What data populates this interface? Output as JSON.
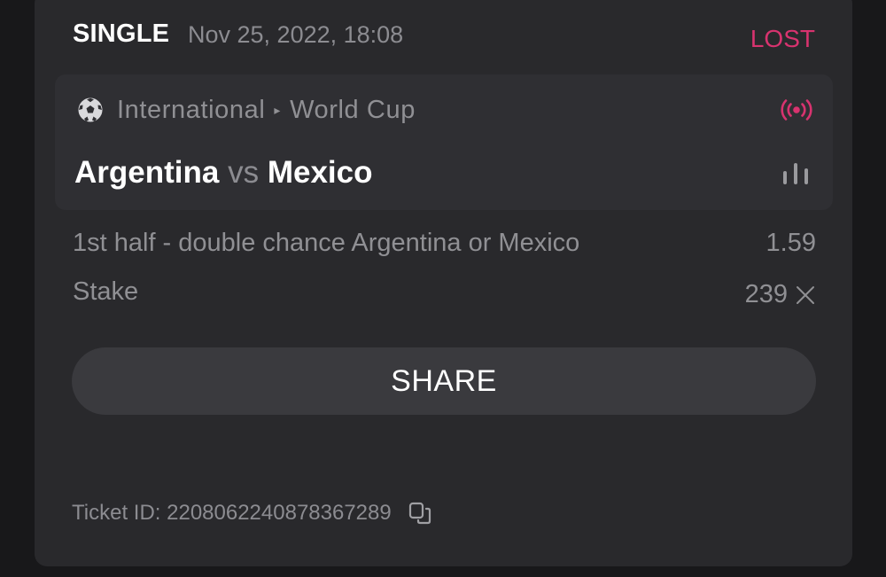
{
  "bet": {
    "type": "SINGLE",
    "date": "Nov 25, 2022, 18:08",
    "status": "LOST"
  },
  "event": {
    "sport_icon": "soccer-ball-icon",
    "category": "International",
    "separator": "▸",
    "league": "World Cup",
    "home": "Argentina",
    "vs": "vs",
    "away": "Mexico",
    "live_icon": "live-broadcast-icon",
    "stats_icon": "bar-chart-icon"
  },
  "selection": {
    "market": "1st half - double chance Argentina or Mexico",
    "odds": "1.59",
    "stake_label": "Stake",
    "stake_value": "239"
  },
  "actions": {
    "share_label": "SHARE"
  },
  "ticket": {
    "label": "Ticket ID: 2208062240878367289",
    "copy_icon": "copy-icon"
  },
  "colors": {
    "lost": "#d8336f",
    "card": "#29292c",
    "event_box": "#2f2f33",
    "button": "#3a3a3e"
  }
}
